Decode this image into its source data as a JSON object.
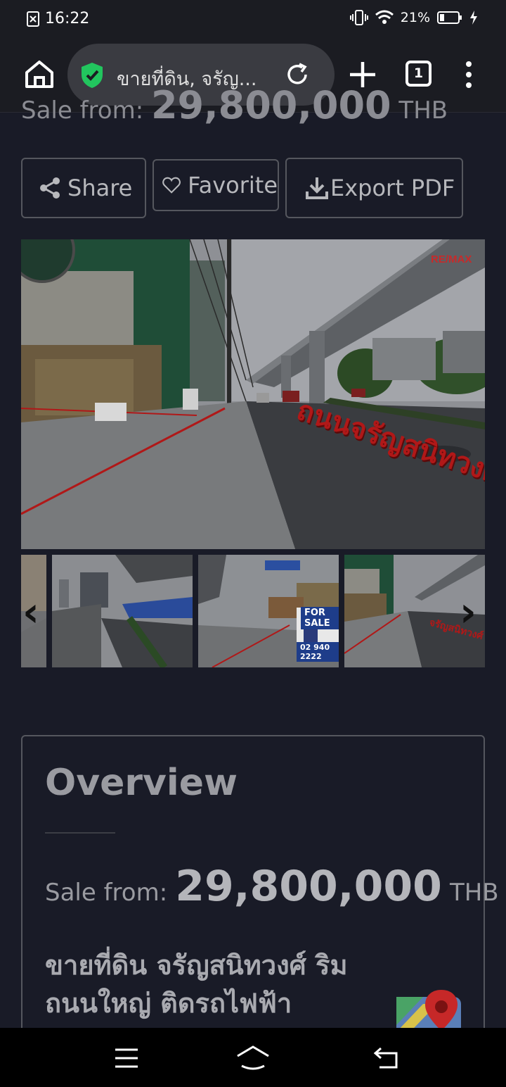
{
  "status_bar": {
    "time": "16:22",
    "battery": "21%",
    "icons": [
      "notification-dismissed-icon",
      "vibrate-icon",
      "wifi-icon",
      "battery-icon",
      "charging-icon"
    ]
  },
  "browser": {
    "url_text": "ขายที่ดิน, จรัญ...",
    "tab_count": "1",
    "icons": [
      "home-icon",
      "secure-shield-icon",
      "reload-icon",
      "new-tab-icon",
      "overflow-menu-icon"
    ],
    "accent": "#22c55e"
  },
  "listing_header": {
    "sale_label": "Sale from:",
    "price": "29,800,000",
    "currency": "THB"
  },
  "actions": {
    "share": "Share",
    "favorite": "Favorite",
    "export_pdf": "Export PDF"
  },
  "gallery": {
    "watermark": "RE/MAX",
    "street_label": "ถนนจรัญสนิทวงศ์",
    "sign_text": "FOR SALE",
    "sign_phone": "02 940 2222",
    "thumbnail_count": 4
  },
  "overview": {
    "title": "Overview",
    "sale_label": "Sale from:",
    "price": "29,800,000",
    "currency": "THB",
    "description": "ขายที่ดิน จรัญสนิทวงศ์ ริมถนนใหญ่ ติดรถไฟฟ้า"
  },
  "nav_bar": {
    "icons": [
      "recents-menu-icon",
      "home-nav-icon",
      "back-icon"
    ]
  }
}
